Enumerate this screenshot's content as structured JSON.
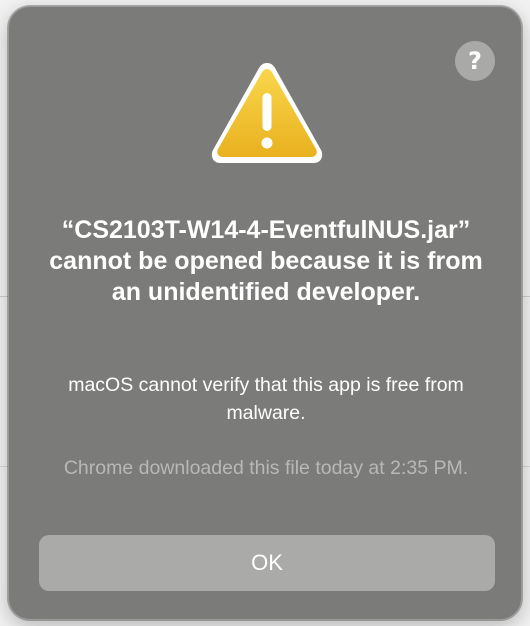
{
  "dialog": {
    "help_label": "?",
    "icon": "warning-triangle-icon",
    "title": "“CS2103T-W14-4-EventfulNUS.jar” cannot be opened because it is from an unidentified developer.",
    "message": "macOS cannot verify that this app is free from malware.",
    "info": "Chrome downloaded this file today at 2:35 PM.",
    "ok_label": "OK"
  },
  "colors": {
    "dialog_background": "#7b7b79",
    "button_background": "#aaaaa8",
    "warning_yellow": "#f4c531",
    "text_primary": "#ffffff",
    "text_secondary": "#b8b8b6"
  }
}
